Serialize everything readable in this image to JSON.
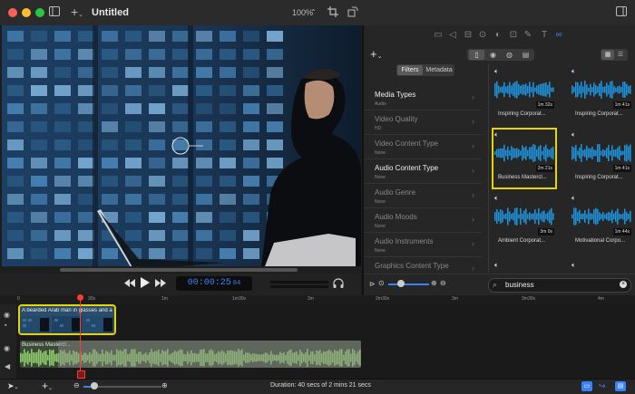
{
  "window": {
    "title": "Untitled",
    "zoom": "100%"
  },
  "viewer": {
    "timecode_main": "00:00:25",
    "timecode_frames": "04"
  },
  "browser": {
    "add_label": "+",
    "tabs": [
      "Filters",
      "Metadata"
    ],
    "filters": [
      {
        "title": "Media Types",
        "sub": "Audio",
        "active": true
      },
      {
        "title": "Video Quality",
        "sub": "HD",
        "active": false
      },
      {
        "title": "Video Content Type",
        "sub": "None",
        "active": false
      },
      {
        "title": "Audio Content Type",
        "sub": "None",
        "active": true
      },
      {
        "title": "Audio Genre",
        "sub": "None",
        "active": false
      },
      {
        "title": "Audio Moods",
        "sub": "None",
        "active": false
      },
      {
        "title": "Audio Instruments",
        "sub": "None",
        "active": false
      },
      {
        "title": "Graphics Content Type",
        "sub": "",
        "active": false
      }
    ],
    "tiles": [
      {
        "name": "Inspiring Corporat...",
        "duration": "1m 32s"
      },
      {
        "name": "Inspiring Corporat...",
        "duration": "1m 41s"
      },
      {
        "name": "Business Mastercl...",
        "duration": "2m 21s"
      },
      {
        "name": "Inspiring Corporat...",
        "duration": "1m 41s"
      },
      {
        "name": "Ambient Corporat...",
        "duration": "3m 0s"
      },
      {
        "name": "Motivational Corpo...",
        "duration": "1m 44s"
      }
    ],
    "search_value": "business"
  },
  "timeline": {
    "ruler": [
      "0",
      "30s",
      "1m",
      "1m30s",
      "2m",
      "2m30s",
      "3m",
      "3m30s",
      "4m"
    ],
    "video_clip_label": "A bearded Arab man in glasses and a sh",
    "audio_clip_label": "Business Mastercl...",
    "duration_text": "Duration: 40 secs of 2 mins 21 secs"
  },
  "colors": {
    "accent": "#3b82f6",
    "selection": "#e6d600",
    "wave": "#1f8fd6",
    "audio_clip": "#8ec96a"
  },
  "icons": [
    "sidebar-icon",
    "add-icon",
    "crop-icon",
    "rotate-icon",
    "speaker-icon",
    "headphones-icon",
    "search-icon",
    "clear-icon",
    "grid-view-icon",
    "list-view-icon",
    "arrow-tool-icon",
    "zoom-out-icon",
    "zoom-in-icon",
    "play-icon",
    "rewind-icon",
    "fast-forward-icon"
  ]
}
